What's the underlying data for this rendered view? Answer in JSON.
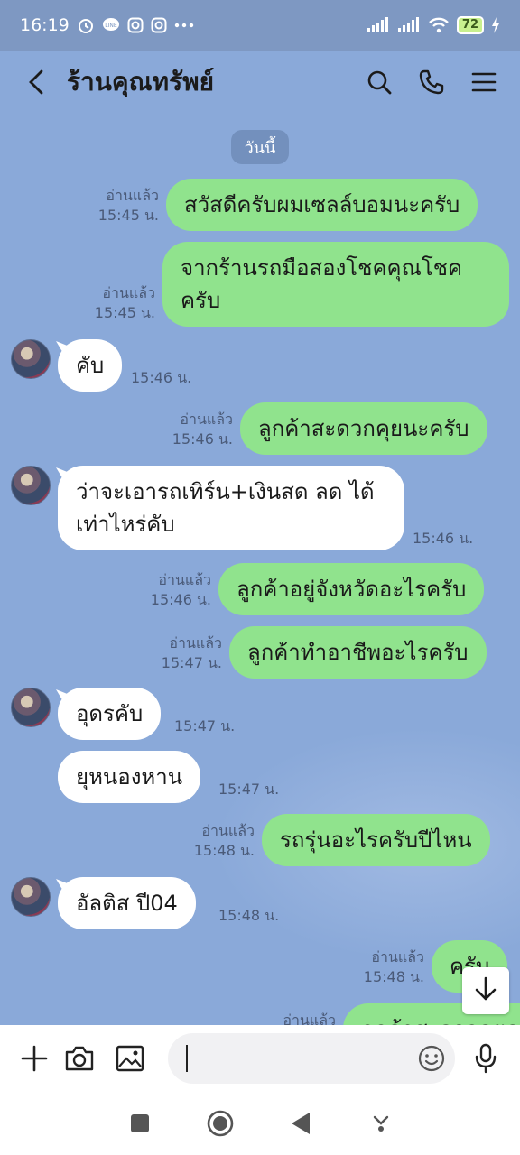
{
  "status_bar": {
    "time": "16:19",
    "battery": "72",
    "left_icons": [
      "alarm-icon",
      "line-icon",
      "instagram-icon",
      "instagram-icon",
      "more-icon"
    ],
    "right_icons": [
      "signal-icon",
      "signal-icon",
      "wifi-icon",
      "battery-icon",
      "charging-icon"
    ]
  },
  "header": {
    "title": "ร้านคุณทรัพย์",
    "icons": [
      "back-icon",
      "search-icon",
      "phone-icon",
      "menu-icon"
    ]
  },
  "chat": {
    "date_label": "วันนี้",
    "messages": [
      {
        "dir": "out",
        "text": "สวัสดีครับผมเซลล์บอมนะครับ",
        "read": "อ่านแล้ว",
        "time": "15:45 น."
      },
      {
        "dir": "out",
        "text": "จากร้านรถมือสองโชคคุณโชค ครับ",
        "read": "อ่านแล้ว",
        "time": "15:45 น."
      },
      {
        "dir": "in",
        "text": "คับ",
        "time": "15:46 น."
      },
      {
        "dir": "out",
        "text": "ลูกค้าสะดวกคุยนะครับ",
        "read": "อ่านแล้ว",
        "time": "15:46 น."
      },
      {
        "dir": "in",
        "text": "ว่าจะเอารถเทิร์น+เงินสด ลด ได้เท่าไหร่คับ",
        "time": "15:46 น."
      },
      {
        "dir": "out",
        "text": "ลูกค้าอยู่จังหวัดอะไรครับ",
        "read": "อ่านแล้ว",
        "time": "15:46 น."
      },
      {
        "dir": "out",
        "text": "ลูกค้าทำอาชีพอะไรครับ",
        "read": "อ่านแล้ว",
        "time": "15:47 น."
      },
      {
        "dir": "in",
        "text": "อุดรคับ",
        "time": "15:47 น."
      },
      {
        "dir": "in",
        "text": "ยุหนองหาน",
        "time": "15:47 น."
      },
      {
        "dir": "out",
        "text": "รถรุ่นอะไรครับปีไหน",
        "read": "อ่านแล้ว",
        "time": "15:48 น."
      },
      {
        "dir": "in",
        "text": "อัลติส  ปี04",
        "time": "15:48 น."
      },
      {
        "dir": "out",
        "text": "ครับ",
        "read": "อ่านแล้ว",
        "time": "15:48 น."
      },
      {
        "dir": "out",
        "text": "ลูกค้าสะดวกคุยครับ",
        "read": "อ่านแล้ว",
        "time": ""
      }
    ]
  },
  "scroll_down_icon": "arrow-down-icon",
  "input_bar": {
    "placeholder": "",
    "icons": [
      "plus-icon",
      "camera-icon",
      "image-icon",
      "emoji-icon",
      "mic-icon"
    ]
  },
  "nav_bar": {
    "icons": [
      "recents-icon",
      "home-icon",
      "back-triangle-icon",
      "assist-icon"
    ]
  }
}
